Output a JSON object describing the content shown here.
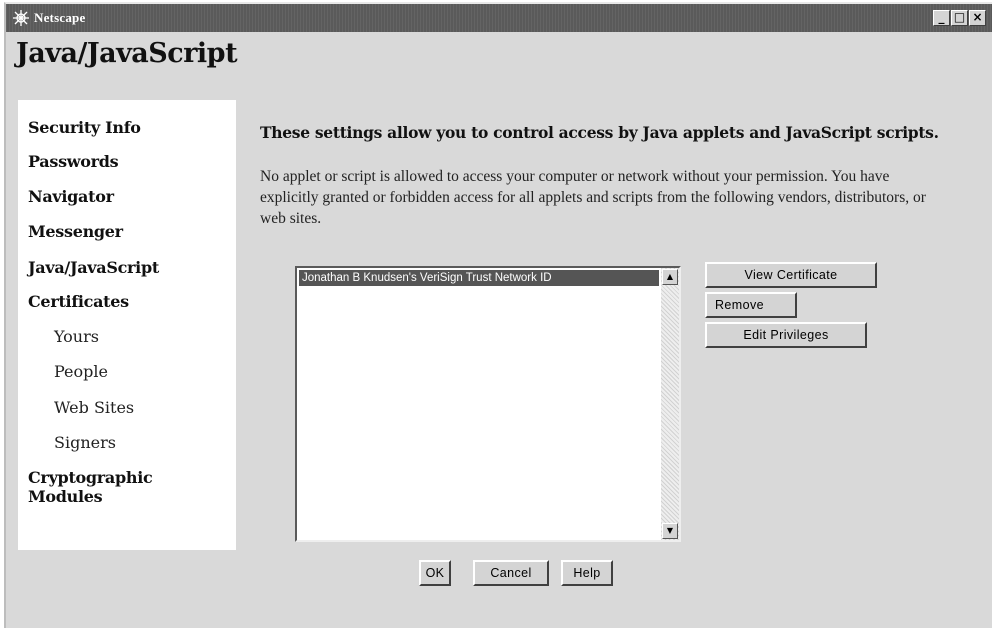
{
  "window": {
    "title": "Netscape",
    "minimize_icon": "minimize-icon",
    "maximize_icon": "maximize-icon",
    "close_icon": "close-icon"
  },
  "panel": {
    "title": "Java/JavaScript"
  },
  "sidebar": {
    "items": [
      {
        "label": "Security Info"
      },
      {
        "label": "Passwords"
      },
      {
        "label": "Navigator"
      },
      {
        "label": "Messenger"
      },
      {
        "label": "Java/JavaScript"
      },
      {
        "label": "Certificates"
      },
      {
        "label": "Yours"
      },
      {
        "label": "People"
      },
      {
        "label": "Web Sites"
      },
      {
        "label": "Signers"
      },
      {
        "label": "Cryptographic"
      },
      {
        "label": "Modules"
      }
    ]
  },
  "content": {
    "heading": "These settings allow you to control access by Java applets and JavaScript scripts.",
    "paragraph": "No applet or script is allowed to access your computer or network without your permission. You have explicitly granted or forbidden access for all applets and scripts from the following vendors, distributors, or web sites.",
    "list_items": [
      "Jonathan B Knudsen's VeriSign Trust Network ID"
    ]
  },
  "buttons": {
    "view_certificate": "View Certificate",
    "remove": "Remove",
    "edit_privileges": "Edit Privileges",
    "ok": "OK",
    "cancel": "Cancel",
    "help": "Help"
  }
}
